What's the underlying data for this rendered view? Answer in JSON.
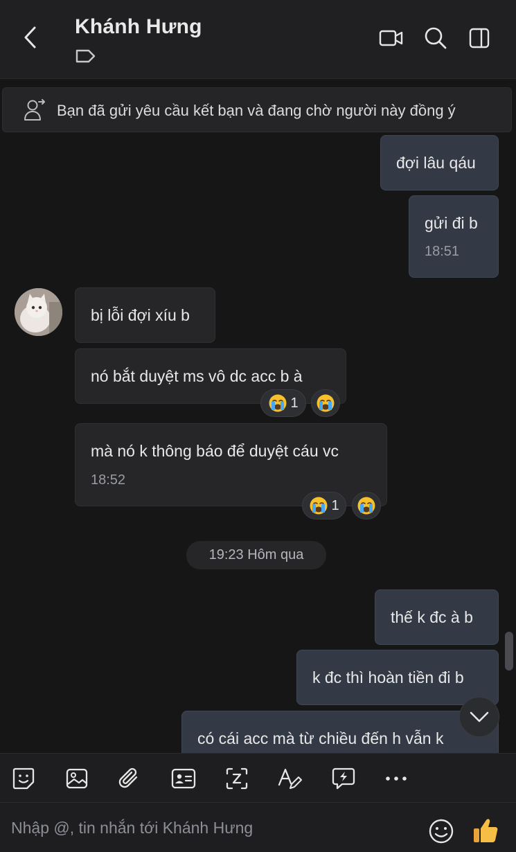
{
  "header": {
    "contact_name": "Khánh Hưng",
    "icons": [
      "back-icon",
      "tag-icon",
      "video-call-icon",
      "search-icon",
      "side-panel-icon"
    ]
  },
  "banner": {
    "text": "Bạn đã gửi yêu cầu kết bạn và đang chờ người này đồng ý",
    "icon": "user-request-icon"
  },
  "messages": [
    {
      "from": "me",
      "text": "đợi lâu qáu"
    },
    {
      "from": "me",
      "text": "gửi đi b",
      "time": "18:51"
    },
    {
      "from": "them",
      "text": "bị lỗi đợi xíu b"
    },
    {
      "from": "them",
      "text": "nó bắt duyệt ms vô dc acc b à",
      "reaction_count": "1"
    },
    {
      "from": "them",
      "text": "mà nó k thông báo để duyệt cáu vc",
      "time": "18:52",
      "reaction_count": "1"
    },
    {
      "from": "me",
      "text": "thế k đc à b"
    },
    {
      "from": "me",
      "text": "k đc thì hoàn tiền đi b"
    },
    {
      "from": "me",
      "text": "có cái acc mà từ chiều đến h vẫn k"
    }
  ],
  "reactions": {
    "emoji": "crying-face-emoji"
  },
  "date_separator": "19:23 Hôm qua",
  "toolbar": {
    "icons": [
      "sticker-icon",
      "image-icon",
      "attachment-icon",
      "contact-card-icon",
      "screenshot-icon",
      "text-format-icon",
      "quick-message-icon",
      "more-icon"
    ]
  },
  "composer": {
    "placeholder": "Nhập @, tin nhắn tới Khánh Hưng",
    "value": "",
    "icons": [
      "emoji-icon",
      "thumbs-up-icon"
    ]
  },
  "colors": {
    "background": "#161616",
    "header": "#202022",
    "my_bubble": "#333a46",
    "their_bubble": "#262629",
    "muted_text": "#9a9ca3"
  }
}
